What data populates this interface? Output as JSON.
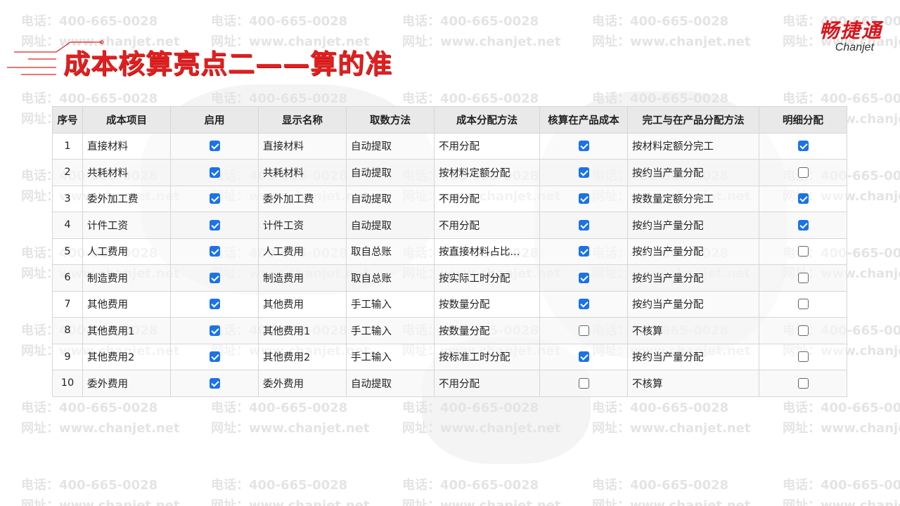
{
  "header": {
    "title": "成本核算亮点二——算的准",
    "logo_cn": "畅捷通",
    "logo_en": "Chanjet"
  },
  "watermark": {
    "phone": "电话：400-665-0028",
    "site": "网址：www.chanjet.net"
  },
  "colors": {
    "title_red": "#e02020",
    "check_blue": "#1a73e8",
    "header_bg": "#e9e9e9"
  },
  "table": {
    "columns": [
      "序号",
      "成本项目",
      "启用",
      "显示名称",
      "取数方法",
      "成本分配方法",
      "核算在产品成本",
      "完工与在产品分配方法",
      "明细分配"
    ],
    "rows": [
      {
        "no": "1",
        "item": "直接材料",
        "enabled": true,
        "display": "直接材料",
        "fetch": "自动提取",
        "alloc": "不用分配",
        "wip": true,
        "complete": "按材料定额分完工",
        "detail": true
      },
      {
        "no": "2",
        "item": "共耗材料",
        "enabled": true,
        "display": "共耗材料",
        "fetch": "自动提取",
        "alloc": "按材料定额分配",
        "wip": true,
        "complete": "按约当产量分配",
        "detail": false
      },
      {
        "no": "3",
        "item": "委外加工费",
        "enabled": true,
        "display": "委外加工费",
        "fetch": "自动提取",
        "alloc": "不用分配",
        "wip": true,
        "complete": "按数量定额分完工",
        "detail": true
      },
      {
        "no": "4",
        "item": "计件工资",
        "enabled": true,
        "display": "计件工资",
        "fetch": "自动提取",
        "alloc": "不用分配",
        "wip": true,
        "complete": "按约当产量分配",
        "detail": true
      },
      {
        "no": "5",
        "item": "人工费用",
        "enabled": true,
        "display": "人工费用",
        "fetch": "取自总账",
        "alloc": "按直接材料占比...",
        "wip": true,
        "complete": "按约当产量分配",
        "detail": false
      },
      {
        "no": "6",
        "item": "制造费用",
        "enabled": true,
        "display": "制造费用",
        "fetch": "取自总账",
        "alloc": "按实际工时分配",
        "wip": true,
        "complete": "按约当产量分配",
        "detail": false
      },
      {
        "no": "7",
        "item": "其他费用",
        "enabled": true,
        "display": "其他费用",
        "fetch": "手工输入",
        "alloc": "按数量分配",
        "wip": true,
        "complete": "按约当产量分配",
        "detail": false
      },
      {
        "no": "8",
        "item": "其他费用1",
        "enabled": true,
        "display": "其他费用1",
        "fetch": "手工输入",
        "alloc": "按数量分配",
        "wip": false,
        "complete": "不核算",
        "detail": false
      },
      {
        "no": "9",
        "item": "其他费用2",
        "enabled": true,
        "display": "其他费用2",
        "fetch": "手工输入",
        "alloc": "按标准工时分配",
        "wip": true,
        "complete": "按约当产量分配",
        "detail": false
      },
      {
        "no": "10",
        "item": "委外费用",
        "enabled": true,
        "display": "委外费用",
        "fetch": "自动提取",
        "alloc": "不用分配",
        "wip": false,
        "complete": "不核算",
        "detail": false
      }
    ]
  }
}
